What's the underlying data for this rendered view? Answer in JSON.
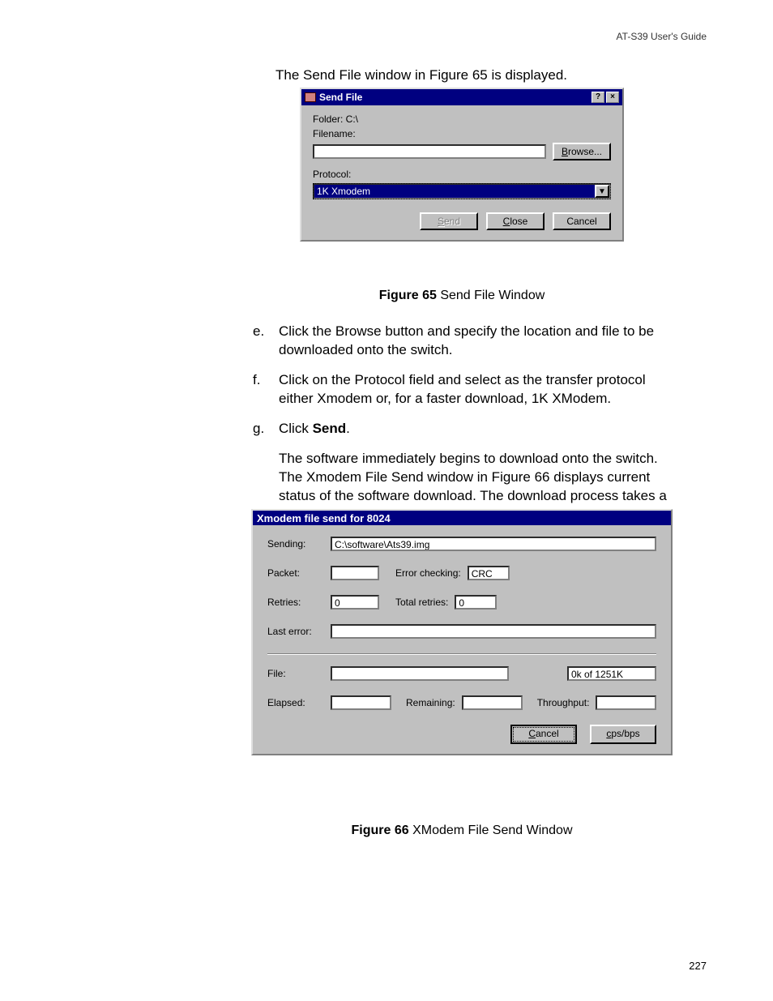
{
  "header": {
    "guide": "AT-S39 User's Guide"
  },
  "intro": "The Send File window in Figure 65 is displayed.",
  "sendfile": {
    "title": "Send File",
    "help_glyph": "?",
    "close_glyph": "×",
    "folder_label": "Folder:  C:\\",
    "filename_label": "Filename:",
    "filename_value": "",
    "browse_label": "Browse...",
    "protocol_label": "Protocol:",
    "protocol_value": "1K Xmodem",
    "dropdown_glyph": "▼",
    "send_label": "Send",
    "close_label": "Close",
    "cancel_label": "Cancel"
  },
  "fig65": {
    "bold": "Figure 65",
    "rest": "  Send File Window"
  },
  "steps": {
    "e": {
      "letter": "e.",
      "text": "Click the Browse button and specify the location and file to be downloaded onto the switch."
    },
    "f": {
      "letter": "f.",
      "text": "Click on the Protocol field and select as the transfer protocol either Xmodem or, for a faster download, 1K XModem."
    },
    "g": {
      "letter": "g.",
      "prefix": "Click ",
      "bold": "Send",
      "suffix": "."
    },
    "g_para": "The software immediately begins to download onto the switch. The Xmodem File Send window in Figure 66 displays current status of the software download. The download process takes a couple minutes to complete."
  },
  "xmodem": {
    "title": "Xmodem file send for 8024",
    "sending_label": "Sending:",
    "sending_value": "C:\\software\\Ats39.img",
    "packet_label": "Packet:",
    "packet_value": "",
    "errchk_label": "Error checking:",
    "errchk_value": "CRC",
    "retries_label": "Retries:",
    "retries_value": "0",
    "totretries_label": "Total retries:",
    "totretries_value": "0",
    "lasterror_label": "Last error:",
    "lasterror_value": "",
    "file_label": "File:",
    "file_progress_value": "0k of 1251K",
    "elapsed_label": "Elapsed:",
    "elapsed_value": "",
    "remaining_label": "Remaining:",
    "remaining_value": "",
    "throughput_label": "Throughput:",
    "throughput_value": "",
    "cancel_label": "Cancel",
    "cpsbps_label": "cps/bps"
  },
  "fig66": {
    "bold": "Figure 66",
    "rest": "  XModem File Send Window"
  },
  "page_number": "227"
}
